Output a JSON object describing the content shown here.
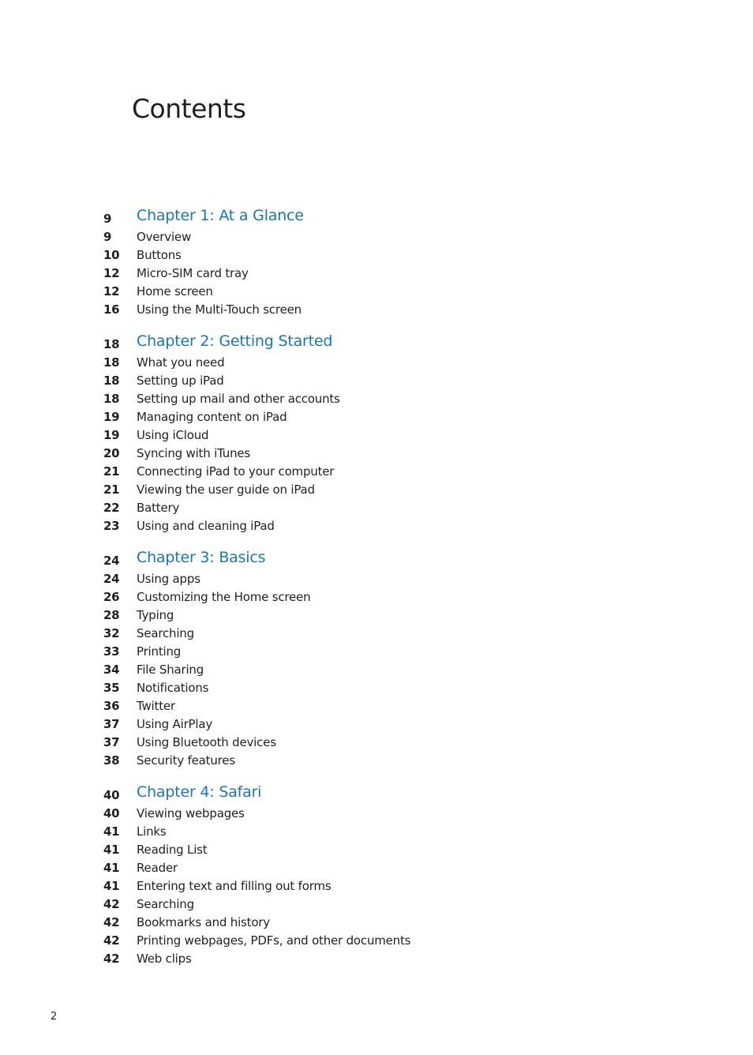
{
  "page": {
    "title": "Contents",
    "page_number": "2",
    "accent_color": "#1a75bc"
  },
  "chapters": [
    {
      "page": "9",
      "title": "Chapter 1: At a Glance",
      "entries": [
        {
          "page": "9",
          "label": "Overview"
        },
        {
          "page": "10",
          "label": "Buttons"
        },
        {
          "page": "12",
          "label": "Micro-SIM card tray"
        },
        {
          "page": "12",
          "label": "Home screen"
        },
        {
          "page": "16",
          "label": "Using the Multi-Touch screen"
        }
      ]
    },
    {
      "page": "18",
      "title": "Chapter 2: Getting Started",
      "entries": [
        {
          "page": "18",
          "label": "What you need"
        },
        {
          "page": "18",
          "label": "Setting up iPad"
        },
        {
          "page": "18",
          "label": "Setting up mail and other accounts"
        },
        {
          "page": "19",
          "label": "Managing content on iPad"
        },
        {
          "page": "19",
          "label": "Using iCloud"
        },
        {
          "page": "20",
          "label": "Syncing with iTunes"
        },
        {
          "page": "21",
          "label": "Connecting iPad to your computer"
        },
        {
          "page": "21",
          "label": "Viewing the user guide on iPad"
        },
        {
          "page": "22",
          "label": "Battery"
        },
        {
          "page": "23",
          "label": "Using and cleaning iPad"
        }
      ]
    },
    {
      "page": "24",
      "title": "Chapter 3: Basics",
      "entries": [
        {
          "page": "24",
          "label": "Using apps"
        },
        {
          "page": "26",
          "label": "Customizing the Home screen"
        },
        {
          "page": "28",
          "label": "Typing"
        },
        {
          "page": "32",
          "label": "Searching"
        },
        {
          "page": "33",
          "label": "Printing"
        },
        {
          "page": "34",
          "label": "File Sharing"
        },
        {
          "page": "35",
          "label": "Notifications"
        },
        {
          "page": "36",
          "label": "Twitter"
        },
        {
          "page": "37",
          "label": "Using AirPlay"
        },
        {
          "page": "37",
          "label": "Using Bluetooth devices"
        },
        {
          "page": "38",
          "label": "Security features"
        }
      ]
    },
    {
      "page": "40",
      "title": "Chapter 4: Safari",
      "entries": [
        {
          "page": "40",
          "label": "Viewing webpages"
        },
        {
          "page": "41",
          "label": "Links"
        },
        {
          "page": "41",
          "label": "Reading List"
        },
        {
          "page": "41",
          "label": "Reader"
        },
        {
          "page": "41",
          "label": "Entering text and filling out forms"
        },
        {
          "page": "42",
          "label": "Searching"
        },
        {
          "page": "42",
          "label": "Bookmarks and history"
        },
        {
          "page": "42",
          "label": "Printing webpages, PDFs, and other documents"
        },
        {
          "page": "42",
          "label": "Web clips"
        }
      ]
    }
  ]
}
